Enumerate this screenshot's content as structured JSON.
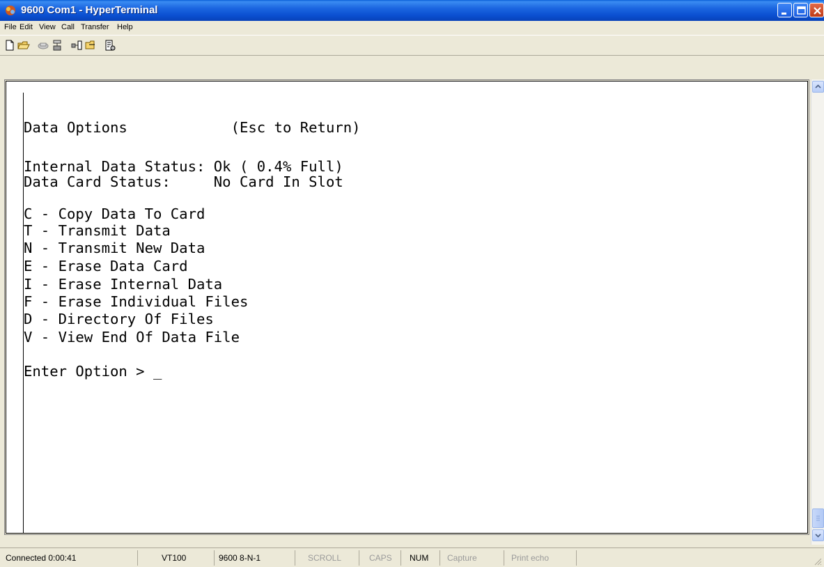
{
  "window": {
    "title": "9600 Com1 - HyperTerminal"
  },
  "menu": {
    "items": [
      "File",
      "Edit",
      "View",
      "Call",
      "Transfer",
      "Help"
    ]
  },
  "toolbar": {
    "buttons": [
      "new-connection-icon",
      "open-icon",
      "connect-icon",
      "disconnect-icon",
      "send-icon",
      "receive-icon",
      "properties-icon"
    ]
  },
  "terminal": {
    "lines": [
      "Data Options            (Esc to Return)",
      "Internal Data Status: Ok ( 0.4% Full)",
      "Data Card Status:     No Card In Slot",
      "C - Copy Data To Card",
      "T - Transmit Data",
      "N - Transmit New Data",
      "E - Erase Data Card",
      "I - Erase Internal Data",
      "F - Erase Individual Files",
      "D - Directory Of Files",
      "V - View End Of Data File",
      "Enter Option > _"
    ]
  },
  "status": {
    "connected": "Connected 0:00:41",
    "emulation": "VT100",
    "settings": "9600 8-N-1",
    "scroll": "SCROLL",
    "caps": "CAPS",
    "num": "NUM",
    "capture": "Capture",
    "print_echo": "Print echo"
  }
}
